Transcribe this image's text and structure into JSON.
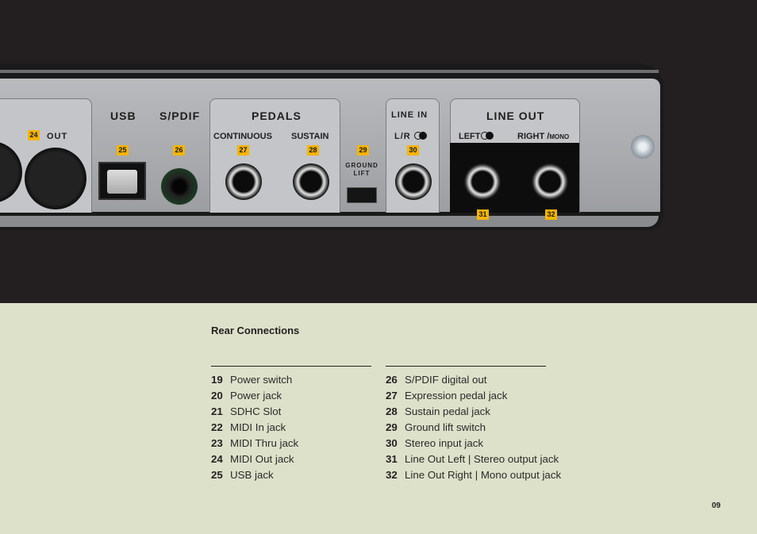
{
  "panel_labels": {
    "out": "OUT",
    "usb": "USB",
    "spdif": "S/PDIF",
    "pedals": "PEDALS",
    "continuous": "CONTINUOUS",
    "sustain": "SUSTAIN",
    "ground_lift": "GROUND LIFT",
    "line_in": "LINE IN",
    "lr": "L/R",
    "line_out": "LINE OUT",
    "left": "LEFT",
    "right": "RIGHT /",
    "mono": "MONO"
  },
  "callouts": [
    "24",
    "25",
    "26",
    "27",
    "28",
    "29",
    "30",
    "31",
    "32"
  ],
  "marker_color": "#f4b400",
  "section_title": "Rear Connections",
  "left_list": [
    {
      "num": "19",
      "label": "Power switch"
    },
    {
      "num": "20",
      "label": "Power jack"
    },
    {
      "num": "21",
      "label": "SDHC Slot"
    },
    {
      "num": "22",
      "label": "MIDI In jack"
    },
    {
      "num": "23",
      "label": "MIDI Thru jack"
    },
    {
      "num": "24",
      "label": "MIDI Out jack"
    },
    {
      "num": "25",
      "label": "USB jack"
    }
  ],
  "right_list": [
    {
      "num": "26",
      "label": "S/PDIF digital out"
    },
    {
      "num": "27",
      "label": "Expression pedal jack"
    },
    {
      "num": "28",
      "label": "Sustain pedal jack"
    },
    {
      "num": "29",
      "label": "Ground lift switch"
    },
    {
      "num": "30",
      "label": "Stereo input jack"
    },
    {
      "num": "31",
      "label": "Line Out Left | Stereo output jack"
    },
    {
      "num": "32",
      "label": "Line Out Right | Mono output jack"
    }
  ],
  "page_number": "09"
}
